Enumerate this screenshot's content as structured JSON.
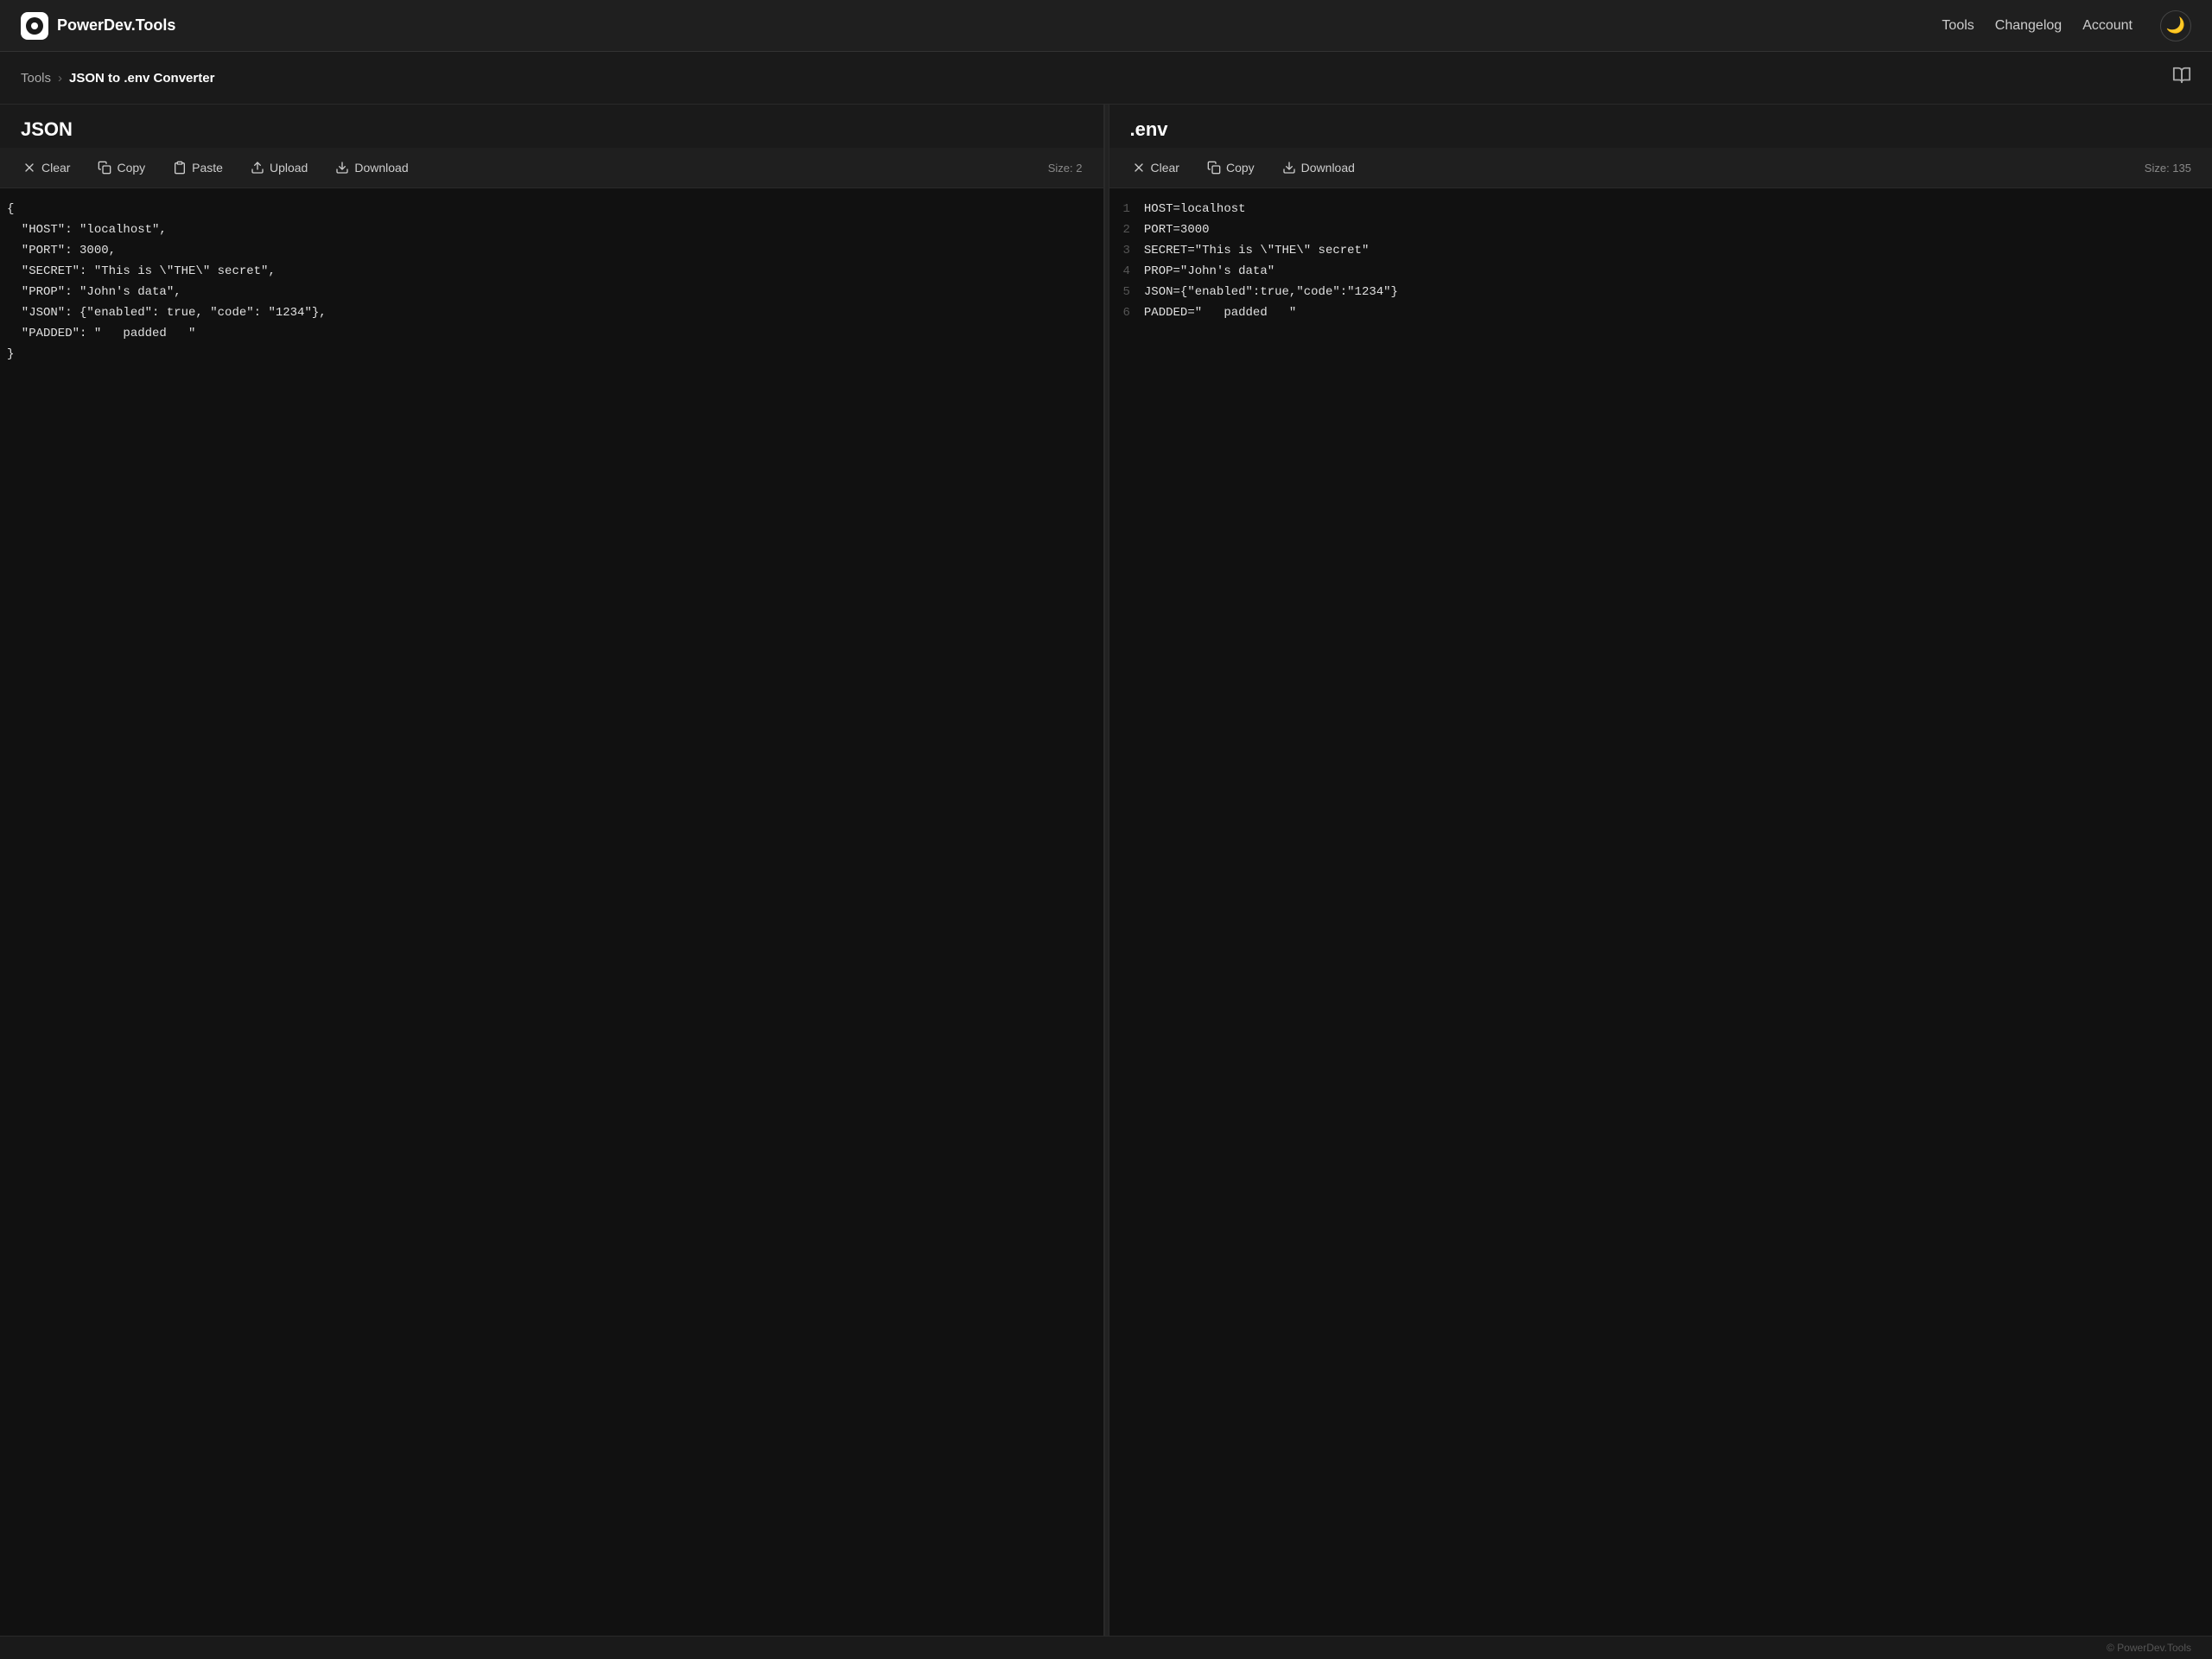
{
  "brand": {
    "name": "PowerDev.Tools"
  },
  "navbar": {
    "links": [
      {
        "label": "Tools",
        "active": false
      },
      {
        "label": "Changelog",
        "active": false
      },
      {
        "label": "Account",
        "active": false
      }
    ],
    "theme_icon": "🌙"
  },
  "breadcrumb": {
    "parent": "Tools",
    "separator": "›",
    "current": "JSON to .env Converter",
    "book_icon": "📖"
  },
  "left_panel": {
    "title": "JSON",
    "toolbar": {
      "clear_label": "Clear",
      "copy_label": "Copy",
      "paste_label": "Paste",
      "upload_label": "Upload",
      "download_label": "Download",
      "size_label": "Size: 2"
    },
    "content": "{\n  \"HOST\": \"localhost\",\n  \"PORT\": 3000,\n  \"SECRET\": \"This is \\\"THE\\\" secret\",\n  \"PROP\": \"John's data\",\n  \"JSON\": {\"enabled\": true, \"code\": \"1234\"},\n  \"PADDED\": \"   padded   \"\n}"
  },
  "right_panel": {
    "title": ".env",
    "toolbar": {
      "clear_label": "Clear",
      "copy_label": "Copy",
      "download_label": "Download",
      "size_label": "Size: 135"
    },
    "lines": [
      {
        "num": 1,
        "content": "HOST=localhost"
      },
      {
        "num": 2,
        "content": "PORT=3000"
      },
      {
        "num": 3,
        "content": "SECRET=\"This is \\\"THE\\\" secret\""
      },
      {
        "num": 4,
        "content": "PROP=\"John's data\""
      },
      {
        "num": 5,
        "content": "JSON={\"enabled\":true,\"code\":\"1234\"}"
      },
      {
        "num": 6,
        "content": "PADDED=\"   padded   \""
      }
    ]
  },
  "footer": {
    "copyright": "© PowerDev.Tools"
  }
}
